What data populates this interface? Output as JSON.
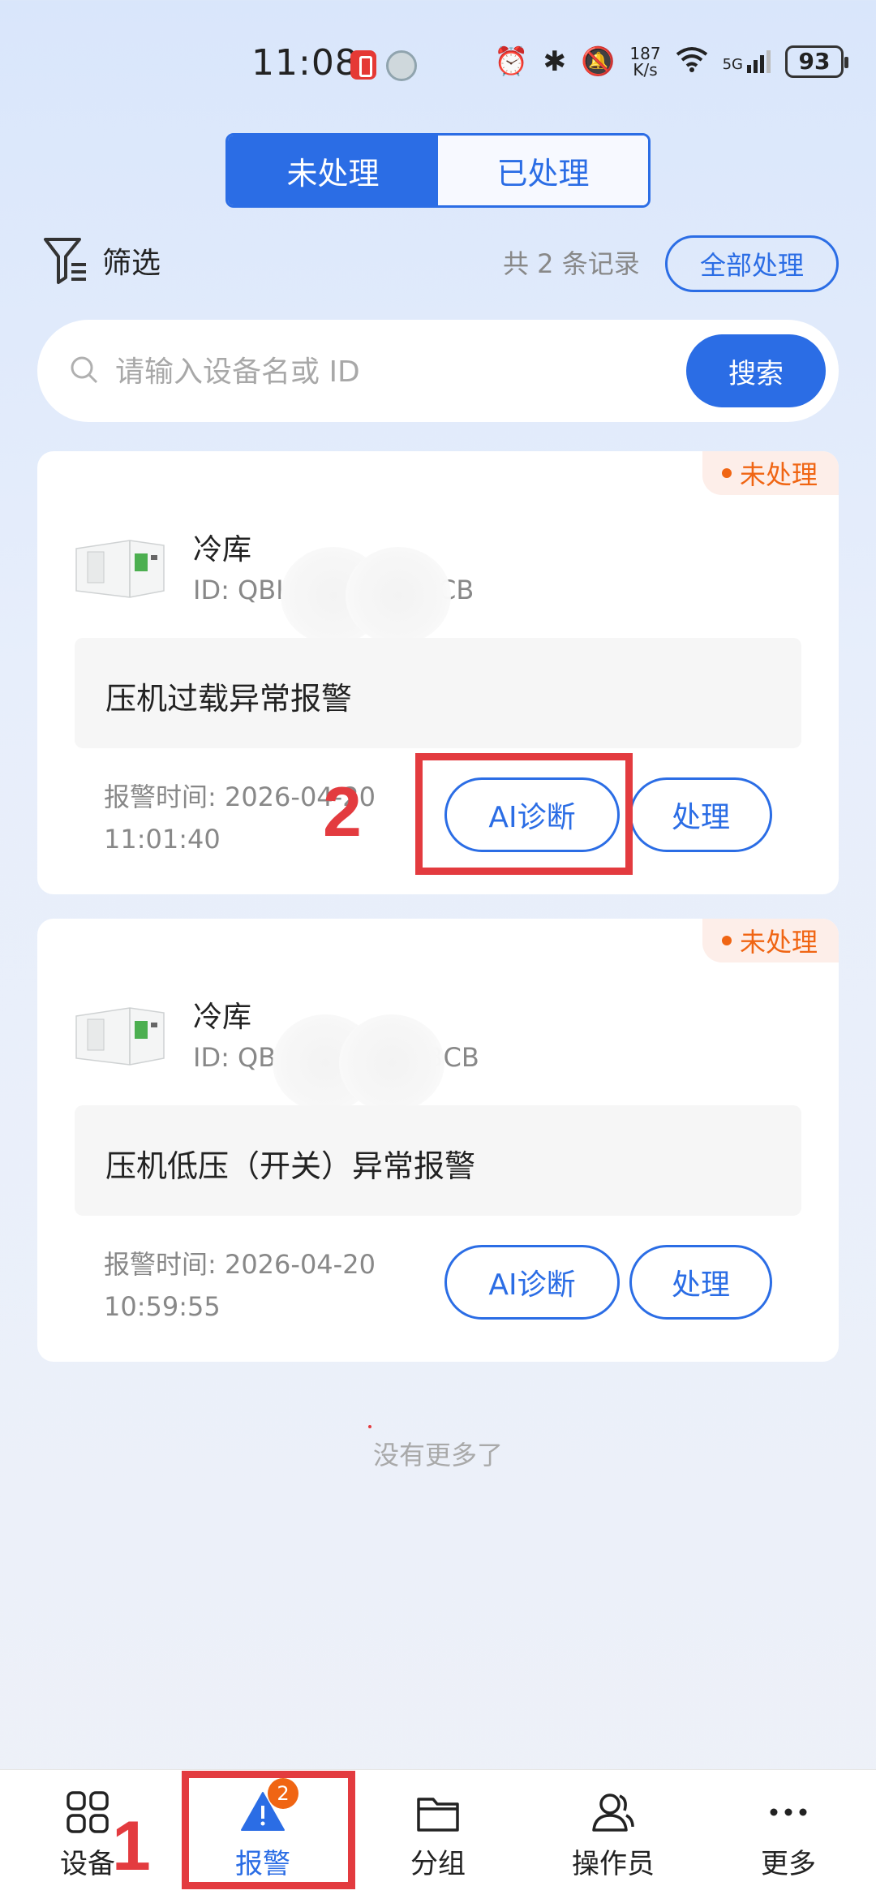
{
  "status_bar": {
    "time": "11:08",
    "net_rate_top": "187",
    "net_rate_bottom": "K/s",
    "signal_label": "5G",
    "battery": "93"
  },
  "tabs": [
    {
      "label": "未处理",
      "active": true
    },
    {
      "label": "已处理",
      "active": false
    }
  ],
  "filter": {
    "label": "筛选"
  },
  "record_count": "共 2 条记录",
  "handle_all_label": "全部处理",
  "search": {
    "placeholder": "请输入设备名或 ID",
    "button_label": "搜索"
  },
  "alarms": [
    {
      "status": "未处理",
      "device_name": "冷库",
      "device_id_prefix": "ID: QBI",
      "device_id_suffix": "3CB",
      "title": "压机过载异常报警",
      "time_line1": "报警时间: 2026-04-20",
      "time_line2": "11:01:40",
      "ai_label": "AI诊断",
      "handle_label": "处理"
    },
    {
      "status": "未处理",
      "device_name": "冷库",
      "device_id_prefix": "ID: QB",
      "device_id_suffix": "3CB",
      "title": "压机低压（开关）异常报警",
      "time_line1": "报警时间: 2026-04-20",
      "time_line2": "10:59:55",
      "ai_label": "AI诊断",
      "handle_label": "处理"
    }
  ],
  "no_more": "没有更多了",
  "annotations": {
    "one": "1",
    "two": "2"
  },
  "bottom_nav": [
    {
      "label": "设备",
      "icon": "grid-icon"
    },
    {
      "label": "报警",
      "icon": "alert-triangle-icon",
      "badge": "2",
      "active": true
    },
    {
      "label": "分组",
      "icon": "folder-icon"
    },
    {
      "label": "操作员",
      "icon": "users-icon"
    },
    {
      "label": "更多",
      "icon": "more-dots-icon"
    }
  ],
  "colors": {
    "primary": "#2b6de5",
    "status_orange": "#f06513",
    "annotation_red": "#e33b3f"
  }
}
